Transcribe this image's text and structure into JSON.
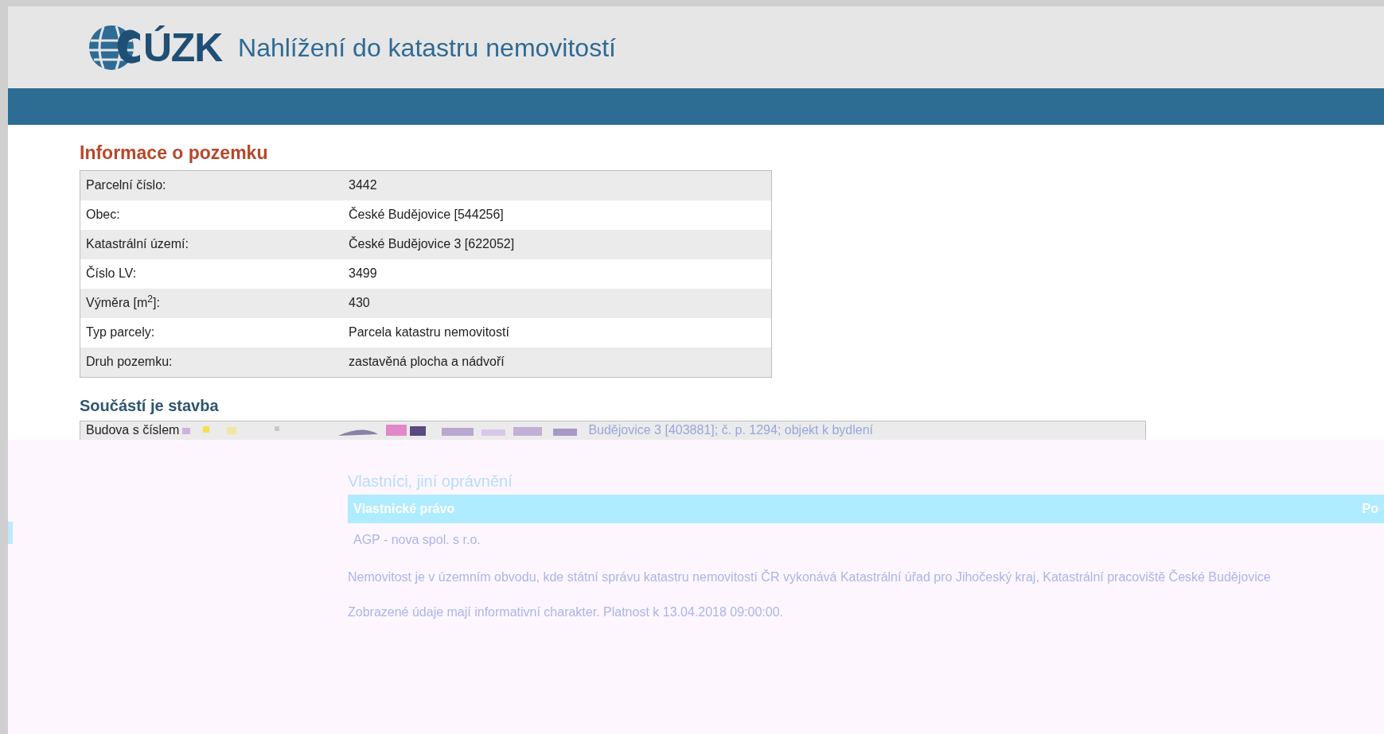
{
  "header": {
    "logo_text": "ÚZK",
    "title": "Nahlížení do katastru nemovitostí"
  },
  "parcel": {
    "heading": "Informace o pozemku",
    "rows": [
      {
        "label": "Parcelní číslo:",
        "value": "3442"
      },
      {
        "label": "Obec:",
        "value": "České Budějovice [544256]"
      },
      {
        "label": "Katastrální území:",
        "value": "České Budějovice 3 [622052]"
      },
      {
        "label": "Číslo LV:",
        "value": "3499"
      },
      {
        "label": "Výměra [m$^{2}$]:",
        "value": "430"
      },
      {
        "label": "Typ parcely:",
        "value": "Parcela katastru nemovitostí"
      },
      {
        "label": "Druh pozemku:",
        "value": "zastavěná plocha a nádvoří"
      }
    ]
  },
  "building": {
    "heading": "Součástí je stavba",
    "text_start": "Budova s číslem",
    "text_end": "Budějovice 3 [403881]; č. p. 1294; objekt k bydlení"
  },
  "owners": {
    "heading": "Vlastníci, jiní oprávnění",
    "columns": [
      "Vlastnické právo",
      "Po"
    ],
    "rows": [
      "AGP - nova spol. s r.o."
    ]
  },
  "notes": [
    "Nemovitost je v územním obvodu, kde státní správu katastru nemovitostí ČR vykonává Katastrální úřad pro Jihočeský kraj, Katastrální pracoviště České Budějovice",
    "Zobrazené údaje mají informativní charakter. Platnost k 13.04.2018 09:00:00."
  ]
}
